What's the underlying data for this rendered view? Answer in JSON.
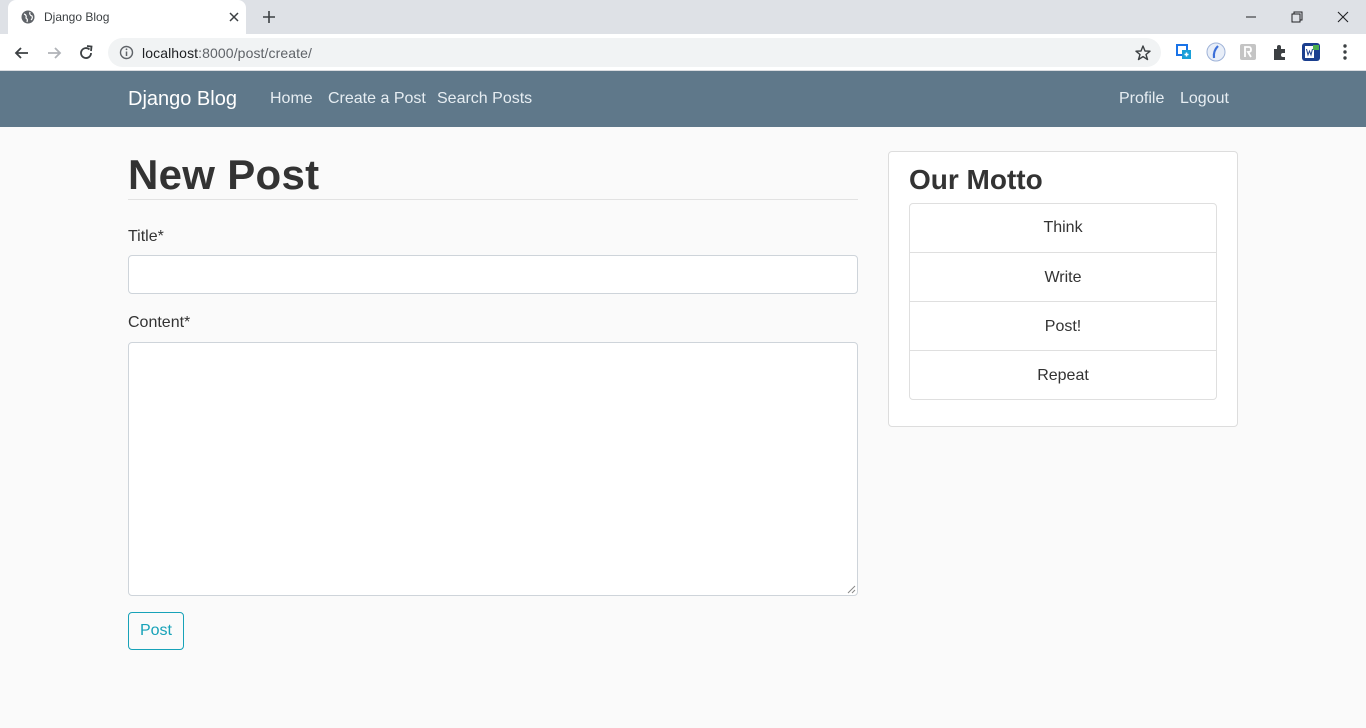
{
  "browser": {
    "tab_title": "Django Blog",
    "url_host": "localhost",
    "url_path": ":8000/post/create/",
    "icons": [
      "globe-icon",
      "close-icon",
      "plus-icon",
      "minimize-icon",
      "restore-icon",
      "close-window-icon",
      "back-icon",
      "forward-icon",
      "reload-icon",
      "info-icon",
      "star-icon",
      "extension-icon",
      "menu-icon"
    ]
  },
  "navbar": {
    "brand": "Django Blog",
    "links": [
      "Home",
      "Create a Post",
      "Search Posts"
    ],
    "right_links": [
      "Profile",
      "Logout"
    ],
    "color": "#5f788a"
  },
  "main": {
    "title": "New Post",
    "form": {
      "title_label": "Title*",
      "title_value": "",
      "content_label": "Content*",
      "content_value": "",
      "submit_label": "Post",
      "submit_color": "#17a2b8"
    }
  },
  "sidebar": {
    "title": "Our Motto",
    "items": [
      "Think",
      "Write",
      "Post!",
      "Repeat"
    ]
  }
}
